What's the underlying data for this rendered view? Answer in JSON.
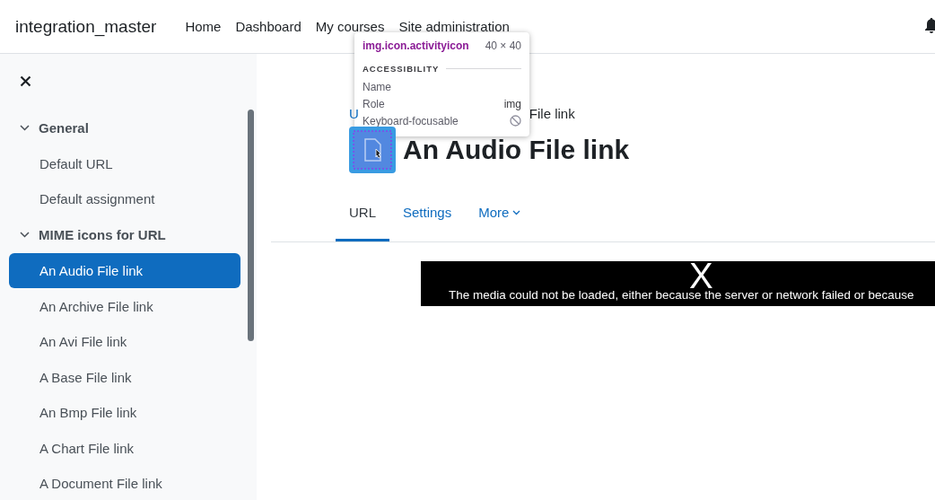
{
  "header": {
    "site_name": "integration_master",
    "nav": [
      {
        "label": "Home"
      },
      {
        "label": "Dashboard"
      },
      {
        "label": "My courses"
      },
      {
        "label": "Site administration"
      }
    ]
  },
  "drawer": {
    "sections": [
      {
        "label": "General",
        "expanded": true,
        "items": [
          {
            "label": "Default URL",
            "selected": false
          },
          {
            "label": "Default assignment",
            "selected": false
          }
        ]
      },
      {
        "label": "MIME icons for URL",
        "expanded": true,
        "items": [
          {
            "label": "An Audio File link",
            "selected": true
          },
          {
            "label": "An Archive File link",
            "selected": false
          },
          {
            "label": "An Avi File link",
            "selected": false
          },
          {
            "label": "A Base File link",
            "selected": false
          },
          {
            "label": "An Bmp File link",
            "selected": false
          },
          {
            "label": "A Chart File link",
            "selected": false
          },
          {
            "label": "A Document File link",
            "selected": false
          }
        ]
      }
    ]
  },
  "breadcrumb": {
    "start": "U",
    "end": "File link"
  },
  "page_title": "An Audio File link",
  "tabs": [
    {
      "label": "URL",
      "selected": true,
      "kind": "link"
    },
    {
      "label": "Settings",
      "selected": false,
      "kind": "link"
    },
    {
      "label": "More",
      "selected": false,
      "kind": "menu"
    }
  ],
  "media_error": {
    "close": "X",
    "message": "The media could not be loaded, either because the server or network failed or because"
  },
  "inspector_tooltip": {
    "selector": "img.icon.activityicon",
    "size": "40 × 40",
    "section": "ACCESSIBILITY",
    "rows": [
      {
        "label": "Name",
        "kind": "text"
      },
      {
        "label": "Role",
        "value": "img",
        "kind": "text"
      },
      {
        "label": "Keyboard-focusable",
        "kind": "blocked"
      }
    ]
  }
}
